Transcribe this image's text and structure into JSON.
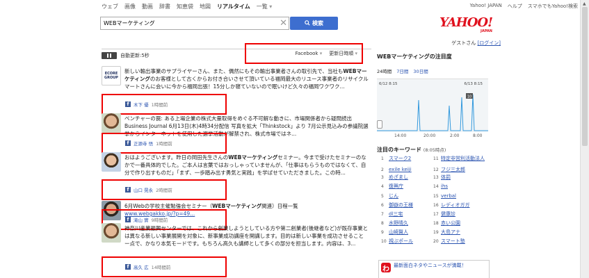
{
  "top_nav": [
    "ウェブ",
    "画像",
    "動画",
    "辞書",
    "知恵袋",
    "地図",
    "リアルタイム",
    "一覧"
  ],
  "top_links": [
    "Yahoo! JAPAN",
    "ヘルプ",
    "スマホでもYahoo!検索"
  ],
  "search": {
    "value": "WEBマーケティング",
    "button": "検索"
  },
  "logo": {
    "main": "YAHOO!",
    "sub": "JAPAN"
  },
  "user": {
    "guest": "ゲストさん",
    "login": "[ログイン]"
  },
  "controls": {
    "auto_update": "自動更新:5秒",
    "source": "Facebook",
    "sort": "更新日時順"
  },
  "feed": [
    {
      "text_a": "新しい輸出事業のサプライヤーさん、また、偶然にもその輸出事業者さんの取引先で、当社も",
      "bold": "WEBマーケティング",
      "text_b": "のお客様として古くからお付き合いさせて頂いている福岡最大のリユース事業者のリサイクルマートさんに会いに今から福岡出張！15分しか寝ていないので眠いけど久々の福岡ワクワク...",
      "name": "木下 優",
      "time": "1時間前",
      "logo_lines": [
        "ECORE",
        "GROUP"
      ]
    },
    {
      "text_a": "ベンチャーの罠: ある上場企業の株式大量取得をめぐる不可解な動きに、市場関係者から疑問続出 Business Journal 6月13日(木)4時34分配信 写真を拡大「Thinkstock」より 7月公示見込みの参議院選挙からインターネットを使用した選挙活動が解禁され、株式市場ではネ...",
      "bold": "",
      "text_b": "",
      "name": "正源寺 悟",
      "time": "1時間前"
    },
    {
      "text_a": "おはようございます。昨日の岡田先生さんの",
      "bold": "WEBマーケティング",
      "text_b": "セミナー。今まで受けたセミナーのなかで一番具体的でした。ご本人は言葉ではおっしゃっていませんが、「仕事はもらうものではなくて、自分で作り出すものだ」「まず、一歩踏み出す勇気と実践」を学ばせていただきました。この時...",
      "name": "山口 晃永",
      "time": "2時間前"
    },
    {
      "text_a": "6月Webの学校主催勉強会セミナー（",
      "bold": "WEBマーケティング",
      "text_b": "関連）日程一覧",
      "link": "www.webgakko.jp/?p=49...",
      "name": "滝山 實",
      "time": "9時間前"
    },
    {
      "text_a": "神奈川産業振興センターでは、これから創業しようとしている方や第二創業者(後継者など)が既存事業とは異なる新しい事業展開を対象に、新事業成功講座を開講します。目的は新しい事業を成功させることー点で、かなり本気モードです。もちろん高久も講師として多くの部分を担当します。内容は、3...",
      "bold": "",
      "text_b": "",
      "name": "高久 広",
      "time": "14時間前"
    }
  ],
  "sidebar": {
    "title": "WEBマーケティングの注目度",
    "tabs": [
      "24時間",
      "7日間",
      "30日間"
    ],
    "graph_start": "6/12 8:15",
    "graph_end": "6/13 8:15",
    "graph_badge": "10",
    "axis_ticks": [
      "14:00",
      "20:00",
      "2:00",
      "8:00"
    ],
    "keyword_title": "注目のキーワード",
    "keyword_time": "(8:05時点)",
    "keywords": [
      {
        "n": "1",
        "w": "スマーク2"
      },
      {
        "n": "2",
        "w": "exile keiji"
      },
      {
        "n": "3",
        "w": "めざまし"
      },
      {
        "n": "4",
        "w": "復興庁"
      },
      {
        "n": "5",
        "w": "じん"
      },
      {
        "n": "6",
        "w": "御嶽の王様"
      },
      {
        "n": "7",
        "w": "dl三宅"
      },
      {
        "n": "8",
        "w": "水野晴久"
      },
      {
        "n": "9",
        "w": "山崎賢人"
      },
      {
        "n": "10",
        "w": "視ぶポール"
      },
      {
        "n": "11",
        "w": "特定非営利活動法人"
      },
      {
        "n": "12",
        "w": "フジ三太郎"
      },
      {
        "n": "13",
        "w": "体罰"
      },
      {
        "n": "14",
        "w": "ihs"
      },
      {
        "n": "15",
        "w": "verbal"
      },
      {
        "n": "16",
        "w": "レディオガガ"
      },
      {
        "n": "17",
        "w": "健康診"
      },
      {
        "n": "18",
        "w": "赤い公園"
      },
      {
        "n": "19",
        "w": "大島アナ"
      },
      {
        "n": "20",
        "w": "スマート塾"
      }
    ],
    "ad_icon": "わ",
    "ad_text": "最新面白ネタやニュースが満載！"
  }
}
